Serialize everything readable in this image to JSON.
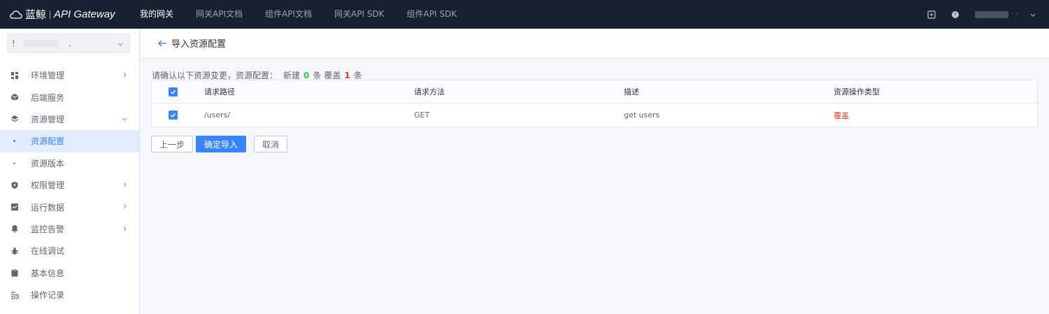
{
  "topbar": {
    "brand": "蓝鲸",
    "product": "API Gateway",
    "nav": [
      "我的网关",
      "网关API文档",
      "组件API文档",
      "网关API SDK",
      "组件API SDK"
    ],
    "active_nav": "我的网关",
    "user_dots": "· ·"
  },
  "sidebar": {
    "project_prefix": "!",
    "project_suffix": ".",
    "menu": [
      {
        "label": "环境管理",
        "icon": "grid-icon",
        "arrow": "right"
      },
      {
        "label": "后端服务",
        "icon": "cube-icon",
        "arrow": "none"
      },
      {
        "label": "资源管理",
        "icon": "layers-icon",
        "arrow": "down"
      },
      {
        "label": "资源配置",
        "icon": "dot",
        "arrow": "none",
        "active": true
      },
      {
        "label": "资源版本",
        "icon": "dot",
        "arrow": "none"
      },
      {
        "label": "权限管理",
        "icon": "shield-icon",
        "arrow": "right"
      },
      {
        "label": "运行数据",
        "icon": "chart-icon",
        "arrow": "right"
      },
      {
        "label": "监控告警",
        "icon": "bell-icon",
        "arrow": "right"
      },
      {
        "label": "在线调试",
        "icon": "bug-icon",
        "arrow": "none"
      },
      {
        "label": "基本信息",
        "icon": "clipboard-icon",
        "arrow": "none"
      },
      {
        "label": "操作记录",
        "icon": "history-icon",
        "arrow": "none"
      }
    ]
  },
  "header": {
    "title": "导入资源配置"
  },
  "summary": {
    "prefix": "请确认以下资源变更，资源配置：",
    "new_label": "新建",
    "new_count": "0",
    "unit1": "条",
    "cover_label": "覆盖",
    "cover_count": "1",
    "unit2": "条"
  },
  "table": {
    "columns": [
      "请求路径",
      "请求方法",
      "描述",
      "资源操作类型"
    ],
    "rows": [
      {
        "path": "/users/",
        "method": "GET",
        "desc": "get users",
        "type": "覆盖",
        "checked": true
      }
    ]
  },
  "buttons": {
    "prev": "上一步",
    "confirm": "确定导入",
    "cancel": "取消"
  },
  "colors": {
    "topbar": "#182132",
    "primary": "#3a84ff",
    "new": "#2dcb56",
    "cover": "#ea3636"
  }
}
